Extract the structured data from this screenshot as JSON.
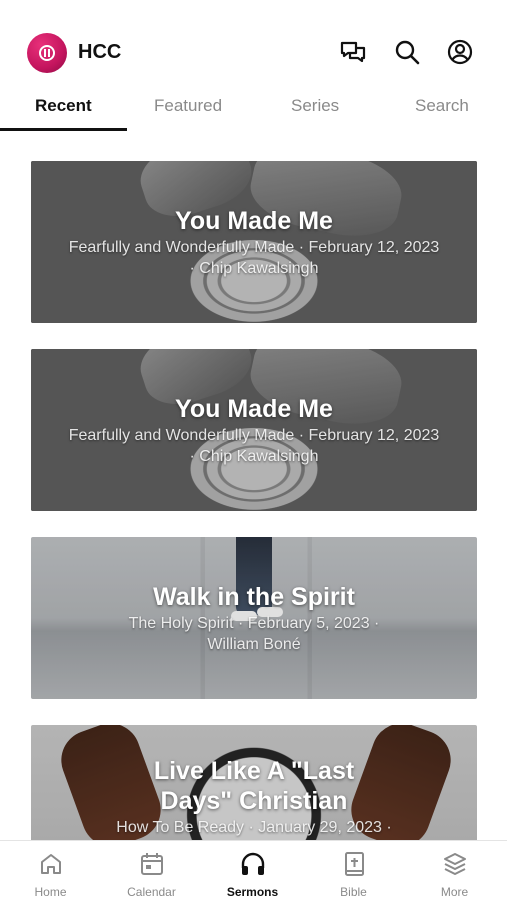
{
  "status_hint": "",
  "header": {
    "title": "HCC"
  },
  "tabs": [
    {
      "label": "Recent"
    },
    {
      "label": "Featured"
    },
    {
      "label": "Series"
    },
    {
      "label": "Search"
    }
  ],
  "sermons": [
    {
      "title": "You Made Me",
      "meta": "Fearfully and Wonderfully Made · February 12, 2023 · Chip Kawalsingh"
    },
    {
      "title": "You Made Me",
      "meta": "Fearfully and Wonderfully Made · February 12, 2023 · Chip Kawalsingh"
    },
    {
      "title": "Walk in the Spirit",
      "meta": "The Holy Spirit · February 5, 2023 · William Boné"
    },
    {
      "title": "Live Like A \"Last Days\" Christian",
      "meta": "How To Be Ready · January 29, 2023 ·"
    }
  ],
  "tabbar": [
    {
      "label": "Home",
      "icon": "home-icon"
    },
    {
      "label": "Calendar",
      "icon": "calendar-icon"
    },
    {
      "label": "Sermons",
      "icon": "headphones-icon"
    },
    {
      "label": "Bible",
      "icon": "bible-icon"
    },
    {
      "label": "More",
      "icon": "layers-icon"
    }
  ],
  "colors": {
    "brand": "#c4155e",
    "active_text": "#111111",
    "inactive_text": "#8a8a8a"
  }
}
